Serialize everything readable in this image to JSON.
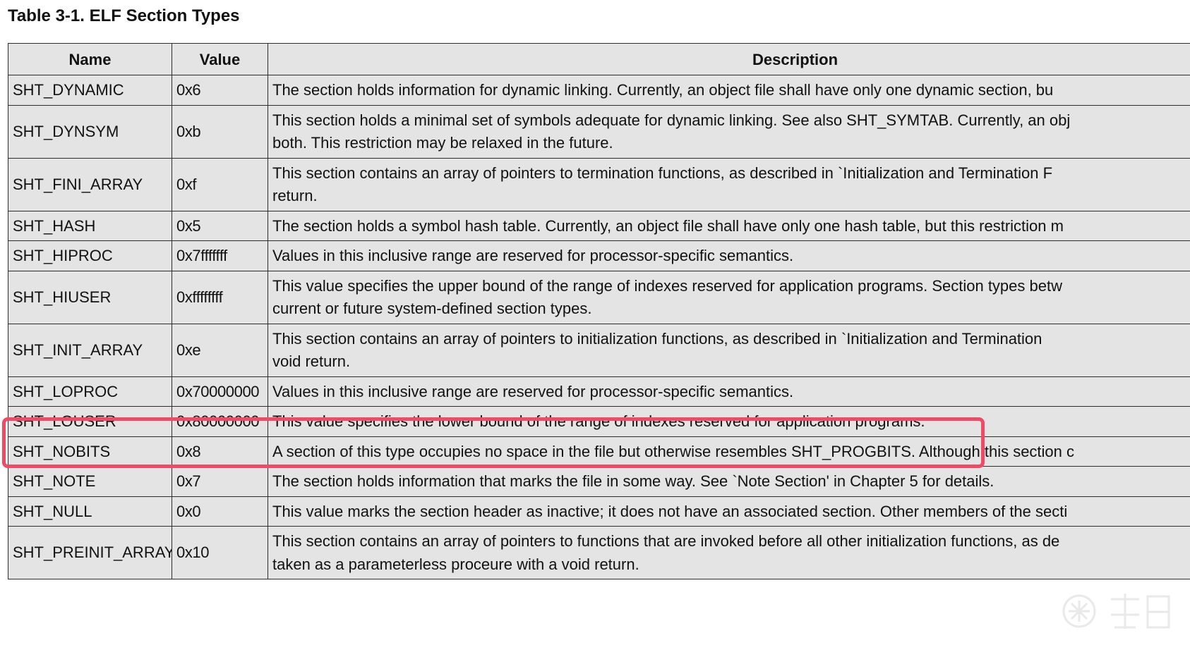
{
  "title": "Table 3-1. ELF Section Types",
  "headers": {
    "name": "Name",
    "value": "Value",
    "description": "Description"
  },
  "rows": [
    {
      "name": "SHT_DYNAMIC",
      "value": "0x6",
      "desc1": "The section holds information for dynamic linking. Currently, an object file shall have only one dynamic section, bu",
      "desc2": ""
    },
    {
      "name": "SHT_DYNSYM",
      "value": "0xb",
      "desc1": "This section holds a minimal set of symbols adequate for dynamic linking. See also SHT_SYMTAB. Currently, an obj",
      "desc2": "both. This restriction may be relaxed in the future."
    },
    {
      "name": "SHT_FINI_ARRAY",
      "value": "0xf",
      "desc1": "This section contains an array of pointers to termination functions, as described in `Initialization and Termination F",
      "desc2": "return."
    },
    {
      "name": "SHT_HASH",
      "value": "0x5",
      "desc1": "The section holds a symbol hash table. Currently, an object file shall have only one hash table, but this restriction m",
      "desc2": ""
    },
    {
      "name": "SHT_HIPROC",
      "value": "0x7fffffff",
      "desc1": "Values in this inclusive range are reserved for processor-specific semantics.",
      "desc2": ""
    },
    {
      "name": "SHT_HIUSER",
      "value": "0xffffffff",
      "desc1": "This value specifies the upper bound of the range of indexes reserved for application programs. Section types betw",
      "desc2": "current or future system-defined section types."
    },
    {
      "name": "SHT_INIT_ARRAY",
      "value": "0xe",
      "desc1": "This section contains an array of pointers to initialization functions, as described in `Initialization and Termination",
      "desc2": "void return."
    },
    {
      "name": "SHT_LOPROC",
      "value": "0x70000000",
      "desc1": "Values in this inclusive range are reserved for processor-specific semantics.",
      "desc2": ""
    },
    {
      "name": "SHT_LOUSER",
      "value": "0x80000000",
      "desc1": "This value specifies the lower bound of the range of indexes reserved for application programs.",
      "desc2": ""
    },
    {
      "name": "SHT_NOBITS",
      "value": "0x8",
      "desc1": "A section of this type occupies no space in the file but otherwise resembles SHT_PROGBITS. Although this section c",
      "desc2": ""
    },
    {
      "name": "SHT_NOTE",
      "value": "0x7",
      "desc1": "The section holds information that marks the file in some way. See `Note Section' in Chapter 5 for details.",
      "desc2": ""
    },
    {
      "name": "SHT_NULL",
      "value": "0x0",
      "desc1": "This value marks the section header as inactive; it does not have an associated section. Other members of the secti",
      "desc2": ""
    },
    {
      "name": "SHT_PREINIT_ARRAY",
      "value": "0x10",
      "desc1": "This section contains an array of pointers to functions that are invoked before all other initialization functions, as de",
      "desc2": "taken as a parameterless proceure with a void return."
    }
  ],
  "highlight": {
    "row_name": "SHT_LOUSER",
    "color": "#f04a64"
  },
  "colors": {
    "cell_background": "#e4e4e4",
    "border": "#2e2e2e",
    "text": "#111111"
  }
}
